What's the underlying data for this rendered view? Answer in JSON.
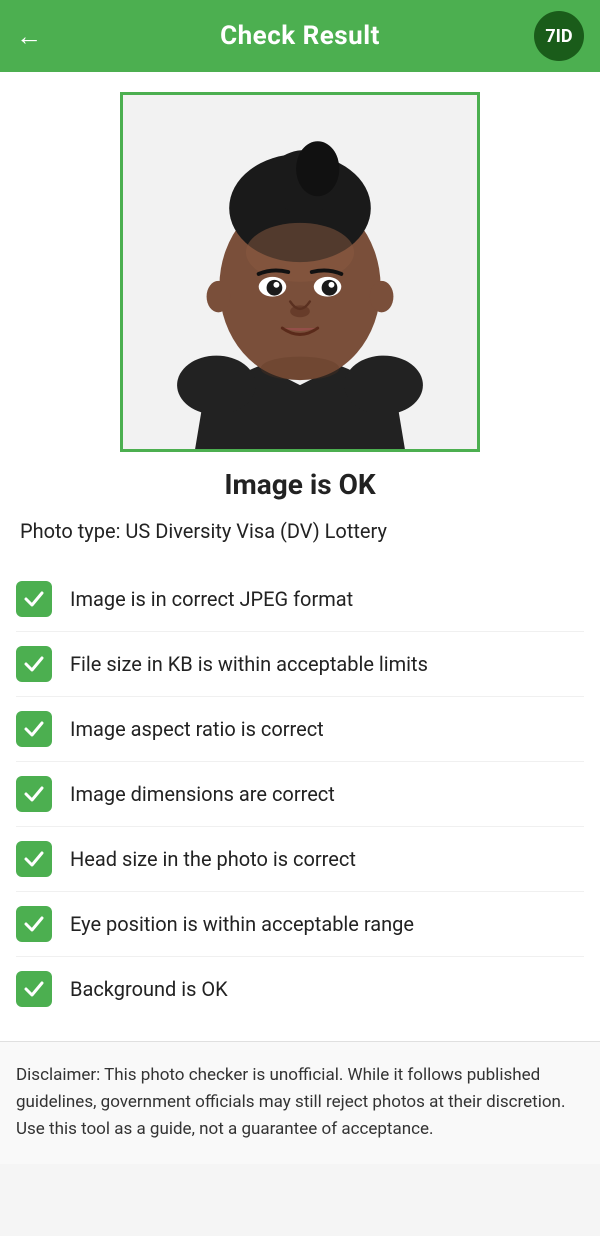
{
  "header": {
    "title": "Check Result",
    "back_icon": "←",
    "logo_text": "7ID"
  },
  "photo": {
    "alt": "Passport photo of a woman"
  },
  "status": {
    "text": "Image is OK"
  },
  "photo_type": {
    "label": "Photo type: US Diversity Visa (DV) Lottery"
  },
  "checks": [
    {
      "id": 1,
      "label": "Image is in correct JPEG format",
      "passed": true
    },
    {
      "id": 2,
      "label": "File size in KB is within acceptable limits",
      "passed": true
    },
    {
      "id": 3,
      "label": "Image aspect ratio is correct",
      "passed": true
    },
    {
      "id": 4,
      "label": "Image dimensions are correct",
      "passed": true
    },
    {
      "id": 5,
      "label": "Head size in the photo is correct",
      "passed": true
    },
    {
      "id": 6,
      "label": "Eye position is within acceptable range",
      "passed": true
    },
    {
      "id": 7,
      "label": "Background is OK",
      "passed": true
    }
  ],
  "disclaimer": {
    "text": "Disclaimer: This photo checker is unofficial. While it follows published guidelines, government officials may still reject photos at their discretion. Use this tool as a guide, not a guarantee of acceptance."
  }
}
